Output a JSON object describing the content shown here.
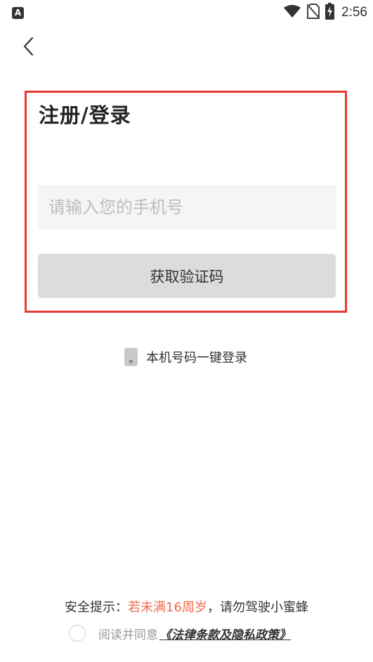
{
  "status_bar": {
    "app_icon_letter": "A",
    "time": "2:56",
    "icons": [
      "wifi-icon",
      "no-sim-icon",
      "battery-charging-icon"
    ]
  },
  "header": {
    "back_icon": "chevron-left-icon"
  },
  "form": {
    "title": "注册/登录",
    "phone_placeholder": "请输入您的手机号",
    "phone_value": "",
    "get_code_label": "获取验证码",
    "highlight_color": "#e53935"
  },
  "one_click_login": {
    "icon": "phone-icon",
    "label": "本机号码一键登录"
  },
  "safety_tip": {
    "prefix": "安全提示：",
    "warning": "若未满16周岁",
    "suffix": "，请勿驾驶小蜜蜂",
    "warning_color": "#f26b4a"
  },
  "agreement": {
    "text": "阅读并同意",
    "link": "《法律条款及隐私政策》",
    "checked": false
  }
}
